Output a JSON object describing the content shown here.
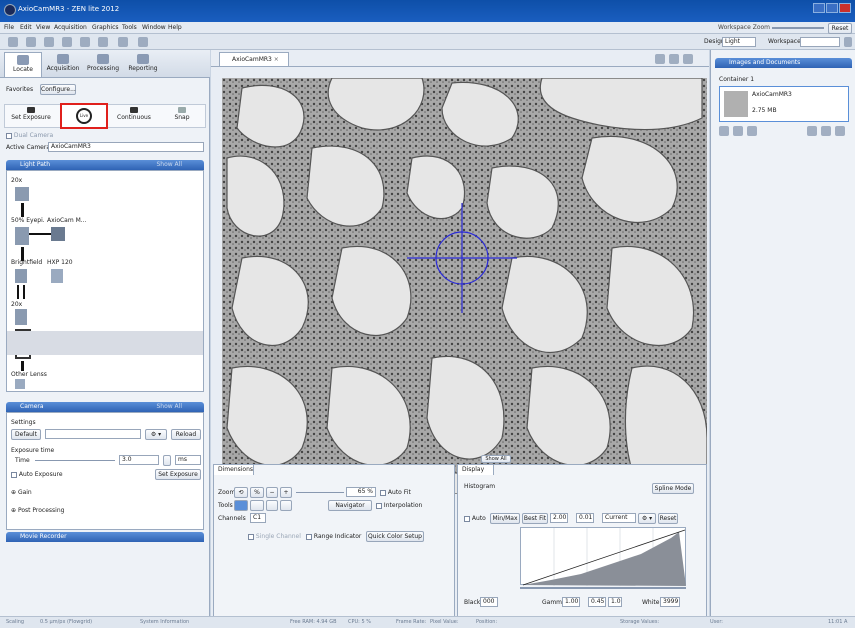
{
  "window": {
    "title": "AxioCamMR3 - ZEN lite 2012"
  },
  "menu": [
    "File",
    "Edit",
    "View",
    "Acquisition",
    "Graphics",
    "Tools",
    "Window",
    "Help"
  ],
  "workspace": {
    "zoom_label": "Workspace Zoom",
    "reset_label": "Reset",
    "design_label": "Design",
    "design_value": "Light",
    "workspace_label": "Workspace"
  },
  "left_tabs": [
    "Locate",
    "Acquisition",
    "Processing",
    "Reporting"
  ],
  "favorites": {
    "label": "Favorites",
    "configure": "Configure..."
  },
  "camera_buttons": [
    "Set Exposure",
    "Live",
    "Continuous",
    "Snap"
  ],
  "dual_camera": "Dual Camera",
  "active_camera": {
    "label": "Active Camera",
    "value": "AxioCamMR3"
  },
  "light_path": {
    "header": "Light Path",
    "header_right": "Show All",
    "labels": [
      "20x",
      "50% Eyepi.",
      "AxioCam M...",
      "Brightfield",
      "HXP 120",
      "20x",
      "Other Lenss"
    ]
  },
  "camera_panel": {
    "header": "Camera",
    "header_right": "Show All",
    "settings_label": "Settings",
    "default_btn": "Default",
    "reload_btn": "Reload",
    "exposure_time_label": "Exposure time",
    "time_label": "Time",
    "time_value": "3.0",
    "time_unit": "ms",
    "auto_exposure": "Auto Exposure",
    "set_exposure": "Set Exposure",
    "gain": "Gain",
    "post_processing": "Post Processing"
  },
  "movie_recorder": {
    "header": "Movie Recorder"
  },
  "document_tab": "AxioCamMR3",
  "dimensions": {
    "tab": "Dimensions",
    "zoom_label": "Zoom",
    "zoom_value": "65 %",
    "auto_fit": "Auto Fit",
    "tools_label": "Tools",
    "navigator": "Navigator",
    "interpolation": "Interpolation",
    "channels_label": "Channels",
    "channel_value": "C1",
    "single_channel": "Single Channel",
    "range_indicator": "Range Indicator",
    "quick_color": "Quick Color Setup",
    "show_all": "Show All"
  },
  "display": {
    "tab": "Display",
    "histogram": "Histogram",
    "spline_mode": "Spline Mode",
    "auto": "Auto",
    "min_max": "Min/Max",
    "best_fit": "Best Fit",
    "v1": "2.00",
    "v2": "0.01",
    "current": "Current",
    "reset": "Reset",
    "black_label": "Black",
    "black_value": "000",
    "gamma_label": "Gamma",
    "gamma_value": "1.00",
    "gamma_range": "0.45",
    "gamma_range2": "1.0",
    "white_label": "White",
    "white_value": "3999"
  },
  "images_docs": {
    "header": "Images and Documents",
    "container": "Container 1",
    "file_name": "AxioCamMR3",
    "file_size": "2.75 MB"
  },
  "status": {
    "items": [
      "Scaling",
      "0.5 µm/px (Flowgrid)",
      "System Information",
      "Free RAM: 4.94 GB",
      "CPU: 5 %",
      "Frame Rate:",
      "Pixel Value:",
      "Position:",
      "Storage Values:",
      "User:"
    ],
    "time": "11:01 A"
  },
  "colors": {
    "titlebar": "#0e4fa8",
    "panel_header": "#2f63b4",
    "highlight": "#e0201c",
    "crosshair": "#2a2ad8"
  }
}
